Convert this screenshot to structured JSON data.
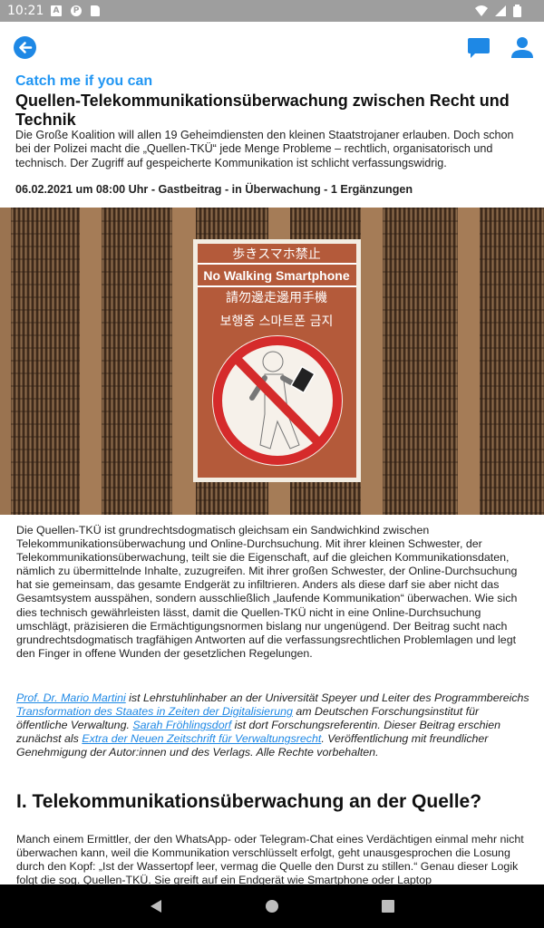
{
  "status_bar": {
    "time": "10:21",
    "icons": [
      "a-notification-icon",
      "p-notification-icon",
      "sd-card-icon",
      "wifi-icon",
      "signal-icon",
      "battery-icon"
    ]
  },
  "app_bar": {
    "icons": [
      "back-arrow-icon",
      "comments-icon",
      "account-icon"
    ],
    "accent_color": "#2196f3"
  },
  "article": {
    "kicker": "Catch me if you can",
    "title": "Quellen-Telekommunikationsüberwachung zwischen Recht und Technik",
    "lead": "Die Große Koalition will allen 19 Geheimdiensten den kleinen Staatstrojaner erlauben. Doch schon bei der Polizei macht die „Quellen-TKÜ“ jede Menge Probleme – rechtlich, organisatorisch und technisch. Der Zugriff auf gespeicherte Kommunikation ist schlicht verfassungswidrig.",
    "meta": "06.02.2021 um 08:00 Uhr - Gastbeitrag - in Überwachung - 1 Ergänzungen",
    "image": {
      "sign_lines": [
        "歩きスマホ禁止",
        "No Walking Smartphone",
        "請勿邊走邊用手機",
        "보행중 스마트폰 금지"
      ]
    },
    "paragraph_1": "Die Quellen-TKÜ ist grundrechtsdogmatisch gleichsam ein Sandwichkind zwischen Telekommunikationsüberwachung und Online-Durchsuchung. Mit ihrer kleinen Schwester, der Telekommunikationsüberwachung, teilt sie die Eigenschaft, auf die gleichen Kommunikationsdaten, nämlich zu übermittelnde Inhalte, zuzugreifen. Mit ihrer großen Schwester, der Online-Durchsuchung hat sie gemeinsam, das gesamte Endgerät zu infiltrieren. Anders als diese darf sie aber nicht das Gesamtsystem ausspähen, sondern ausschließlich „laufende Kommunikation“ überwachen. Wie sich dies technisch gewährleisten lässt, damit die Quellen-TKÜ nicht in eine Online-Durchsuchung umschlägt, präzisieren die Ermächtigungsnormen bislang nur ungenügend. Der Beitrag sucht nach grundrechtsdogmatisch tragfähigen Antworten auf die verfassungsrechtlichen Problemlagen und legt den Finger in offene Wunden der gesetzlichen Regelungen.",
    "credit": {
      "link_1": "Prof. Dr. Mario Martini",
      "text_1": " ist Lehrstuhlinhaber an der Universität Speyer und Leiter des Programmbereichs ",
      "link_2": "Transformation des Staates in Zeiten der Digitalisierung",
      "text_2": " am Deutschen Forschungsinstitut für öffentliche Verwaltung. ",
      "link_3": "Sarah Fröhlingsdorf",
      "text_3": " ist dort Forschungsreferentin. Dieser Beitrag erschien zunächst als ",
      "link_4": "Extra der Neuen Zeitschrift für Verwaltungsrecht",
      "text_4": ". Veröffentlichung mit freundlicher Genehmigung der Autor:innen und des Verlags. Alle Rechte vorbehalten."
    },
    "section_heading": "I. Telekommunikationsüberwachung an der Quelle?",
    "paragraph_2": "Manch einem Ermittler, der den WhatsApp- oder Telegram-Chat eines Verdächtigen einmal mehr nicht überwachen kann, weil die Kommunikation verschlüsselt erfolgt, geht unausgesprochen die Losung durch den Kopf: „Ist der Wassertopf leer, vermag die Quelle den Durst zu stillen.“ Genau dieser Logik folgt die sog. Quellen-TKÜ. Sie greift auf ein Endgerät wie Smartphone oder Laptop"
  },
  "nav_bar": {
    "icons": [
      "nav-back-icon",
      "nav-home-icon",
      "nav-recents-icon"
    ]
  }
}
